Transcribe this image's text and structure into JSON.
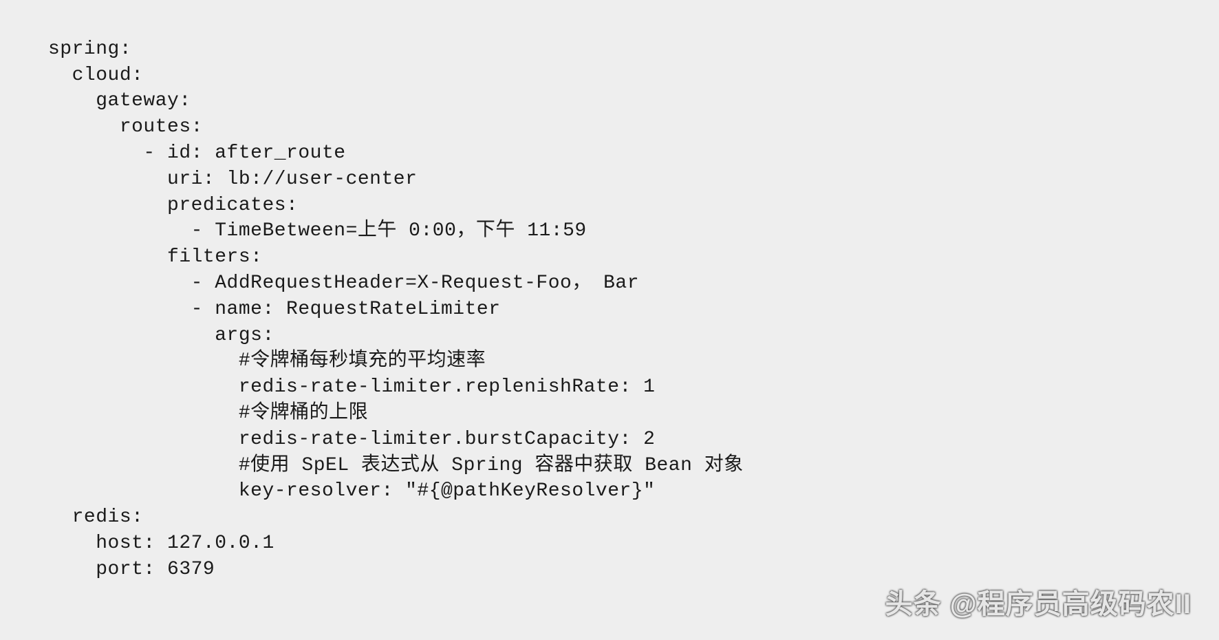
{
  "code": {
    "l01": "spring:",
    "l02": "  cloud:",
    "l03": "    gateway:",
    "l04": "      routes:",
    "l05": "        - id: after_route",
    "l06": "          uri: lb://user-center",
    "l07": "          predicates:",
    "l08": "            - TimeBetween=上午 0:00，下午 11:59",
    "l09": "          filters:",
    "l10": "            - AddRequestHeader=X-Request-Foo， Bar",
    "l11": "            - name: RequestRateLimiter",
    "l12": "              args:",
    "l13": "                #令牌桶每秒填充的平均速率",
    "l14": "                redis-rate-limiter.replenishRate: 1",
    "l15": "                #令牌桶的上限",
    "l16": "                redis-rate-limiter.burstCapacity: 2",
    "l17": "                #使用 SpEL 表达式从 Spring 容器中获取 Bean 对象",
    "l18": "                key-resolver: \"#{@pathKeyResolver}\"",
    "l19": "  redis:",
    "l20": "    host: 127.0.0.1",
    "l21": "    port: 6379"
  },
  "watermark": "头条 @程序员高级码农II"
}
